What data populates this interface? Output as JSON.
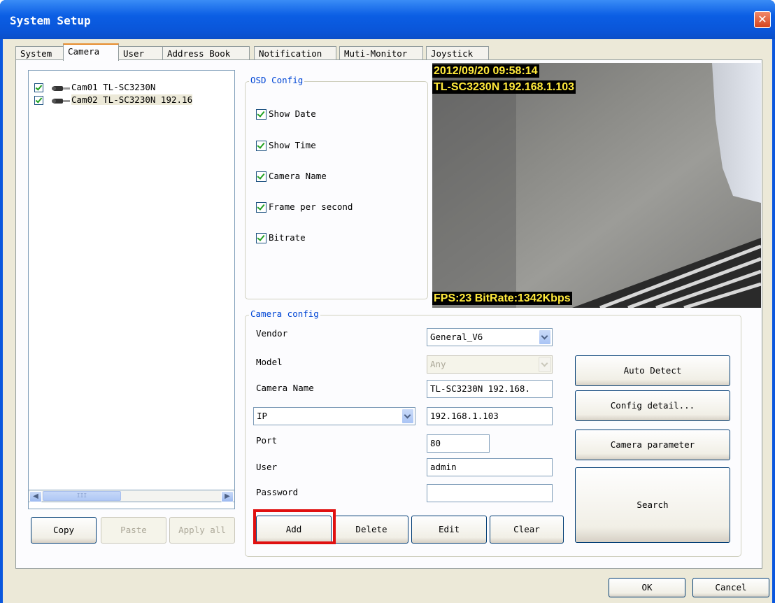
{
  "window": {
    "title": "System Setup",
    "close_icon": "close-icon"
  },
  "tabs": [
    {
      "label": "System"
    },
    {
      "label": "Camera",
      "active": true
    },
    {
      "label": "User"
    },
    {
      "label": "Address Book"
    },
    {
      "label": "Notification"
    },
    {
      "label": "Muti-Monitor"
    },
    {
      "label": "Joystick"
    }
  ],
  "camera_list": {
    "items": [
      {
        "label": "Cam01 TL-SC3230N",
        "checked": true,
        "icon": "camera-icon"
      },
      {
        "label": "Cam02 TL-SC3230N 192.16",
        "checked": true,
        "icon": "camera-icon",
        "selected": true
      }
    ],
    "scroll_thumb_grip": "III"
  },
  "list_buttons": {
    "copy": "Copy",
    "paste": "Paste",
    "apply_all": "Apply all"
  },
  "osd": {
    "group_label": "OSD Config",
    "options": [
      {
        "label": "Show Date",
        "checked": true
      },
      {
        "label": "Show Time",
        "checked": true
      },
      {
        "label": "Camera Name",
        "checked": true
      },
      {
        "label": "Frame per second",
        "checked": true
      },
      {
        "label": "Bitrate",
        "checked": true
      }
    ]
  },
  "preview": {
    "datetime": "2012/09/20 09:58:14",
    "camera_label": "TL-SC3230N 192.168.1.103",
    "stats": "FPS:23 BitRate:1342Kbps"
  },
  "camera_config": {
    "group_label": "Camera config",
    "vendor_label": "Vendor",
    "vendor_value": "General_V6",
    "model_label": "Model",
    "model_value": "Any",
    "camera_name_label": "Camera Name",
    "camera_name_value": "TL-SC3230N 192.168.",
    "address_type_value": "IP",
    "address_value": "192.168.1.103",
    "port_label": "Port",
    "port_value": "80",
    "user_label": "User",
    "user_value": "admin",
    "password_label": "Password",
    "password_value": ""
  },
  "config_buttons": {
    "auto_detect": "Auto Detect",
    "config_detail": "Config detail...",
    "camera_parameter": "Camera parameter",
    "search": "Search",
    "add": "Add",
    "delete": "Delete",
    "edit": "Edit",
    "clear": "Clear"
  },
  "dialog_buttons": {
    "ok": "OK",
    "cancel": "Cancel"
  },
  "highlight_color": "#e01010"
}
